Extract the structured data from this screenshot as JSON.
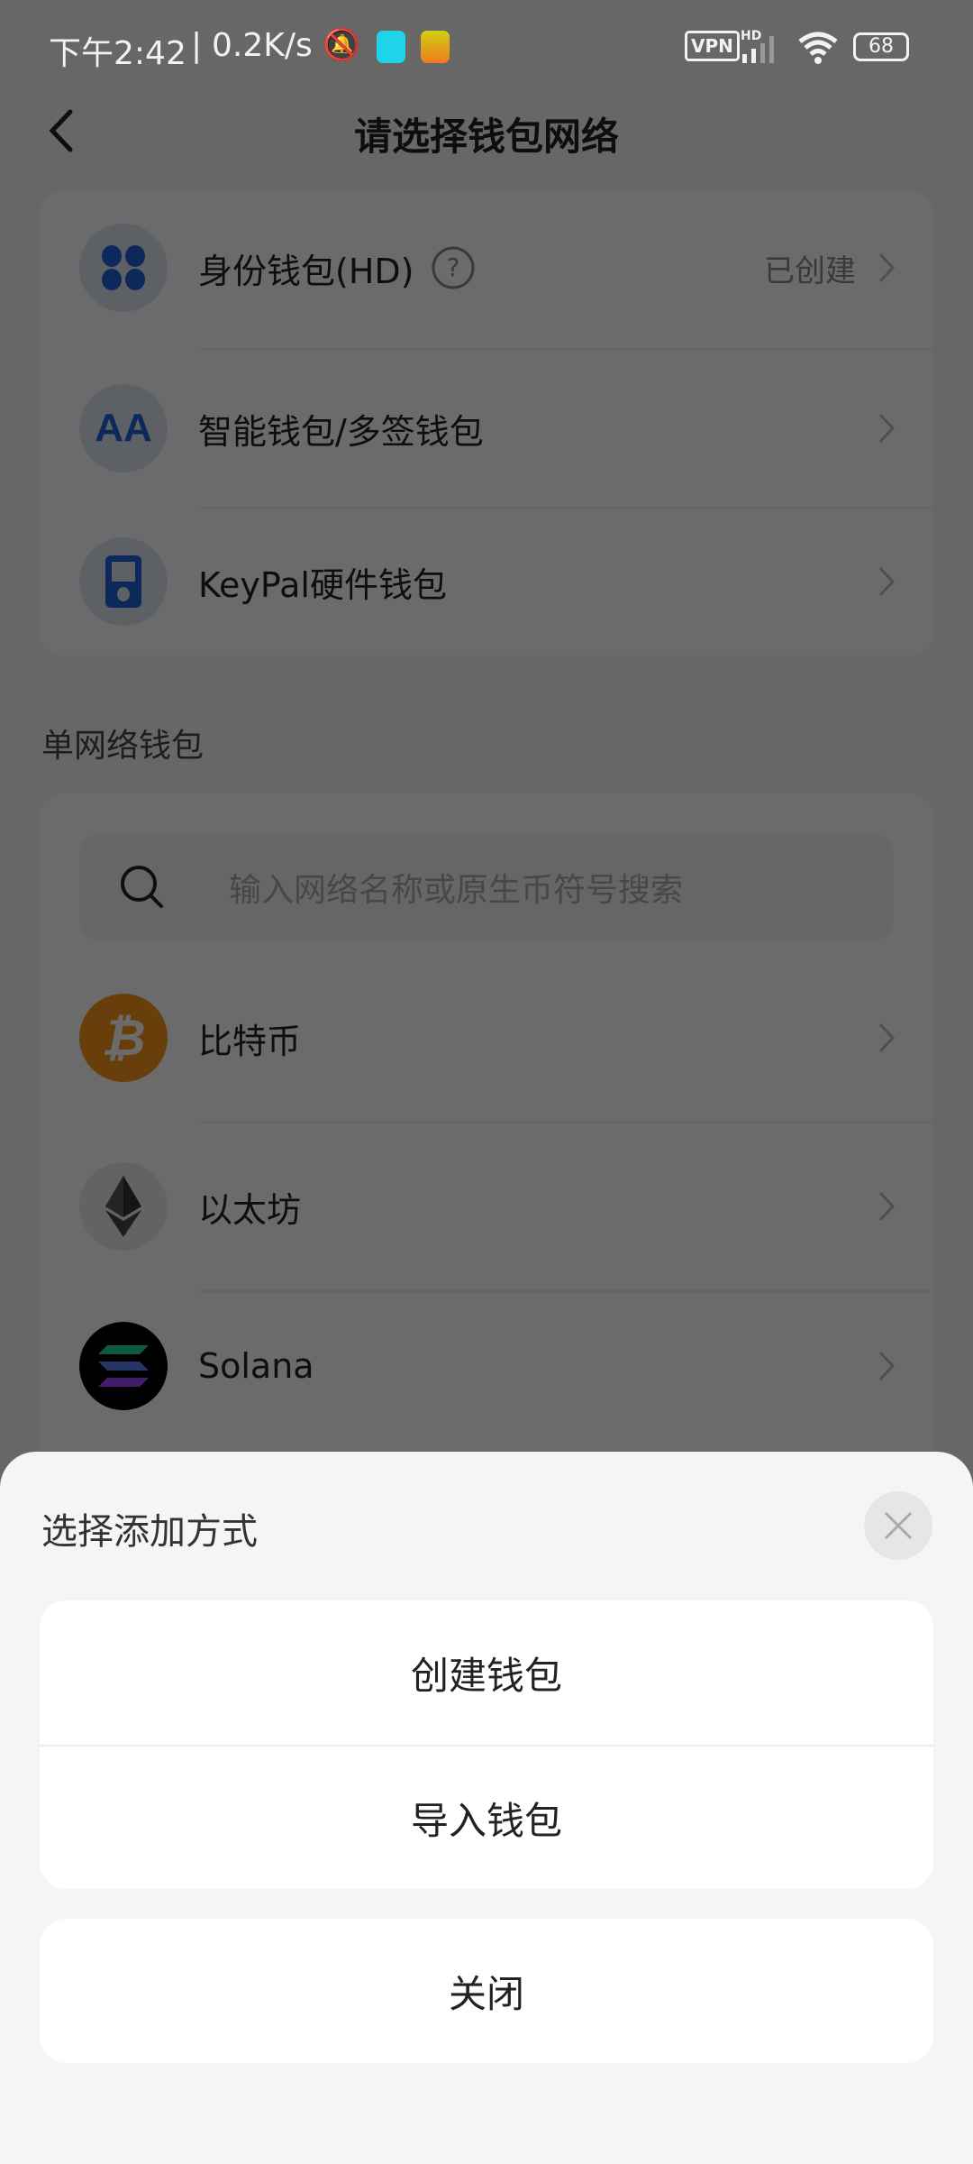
{
  "status_bar": {
    "time": "下午2:42",
    "speed": "0.2K/s",
    "vpn": "VPN",
    "hd": "HD",
    "battery": "68"
  },
  "header": {
    "title": "请选择钱包网络"
  },
  "wallet_types": [
    {
      "label": "身份钱包(HD)",
      "status": "已创建",
      "icon": "identity-wallet-icon"
    },
    {
      "label": "智能钱包/多签钱包",
      "icon_text": "AA",
      "icon": "aa-wallet-icon"
    },
    {
      "label": "KeyPal硬件钱包",
      "icon": "hardware-wallet-icon"
    }
  ],
  "single_network": {
    "section_title": "单网络钱包",
    "search_placeholder": "输入网络名称或原生币符号搜索",
    "networks": [
      {
        "label": "比特币",
        "icon": "bitcoin-icon",
        "color": "#f7931a"
      },
      {
        "label": "以太坊",
        "icon": "ethereum-icon"
      },
      {
        "label": "Solana",
        "icon": "solana-icon"
      }
    ]
  },
  "sheet": {
    "title": "选择添加方式",
    "options": [
      "创建钱包",
      "导入钱包"
    ],
    "close_label": "关闭"
  }
}
